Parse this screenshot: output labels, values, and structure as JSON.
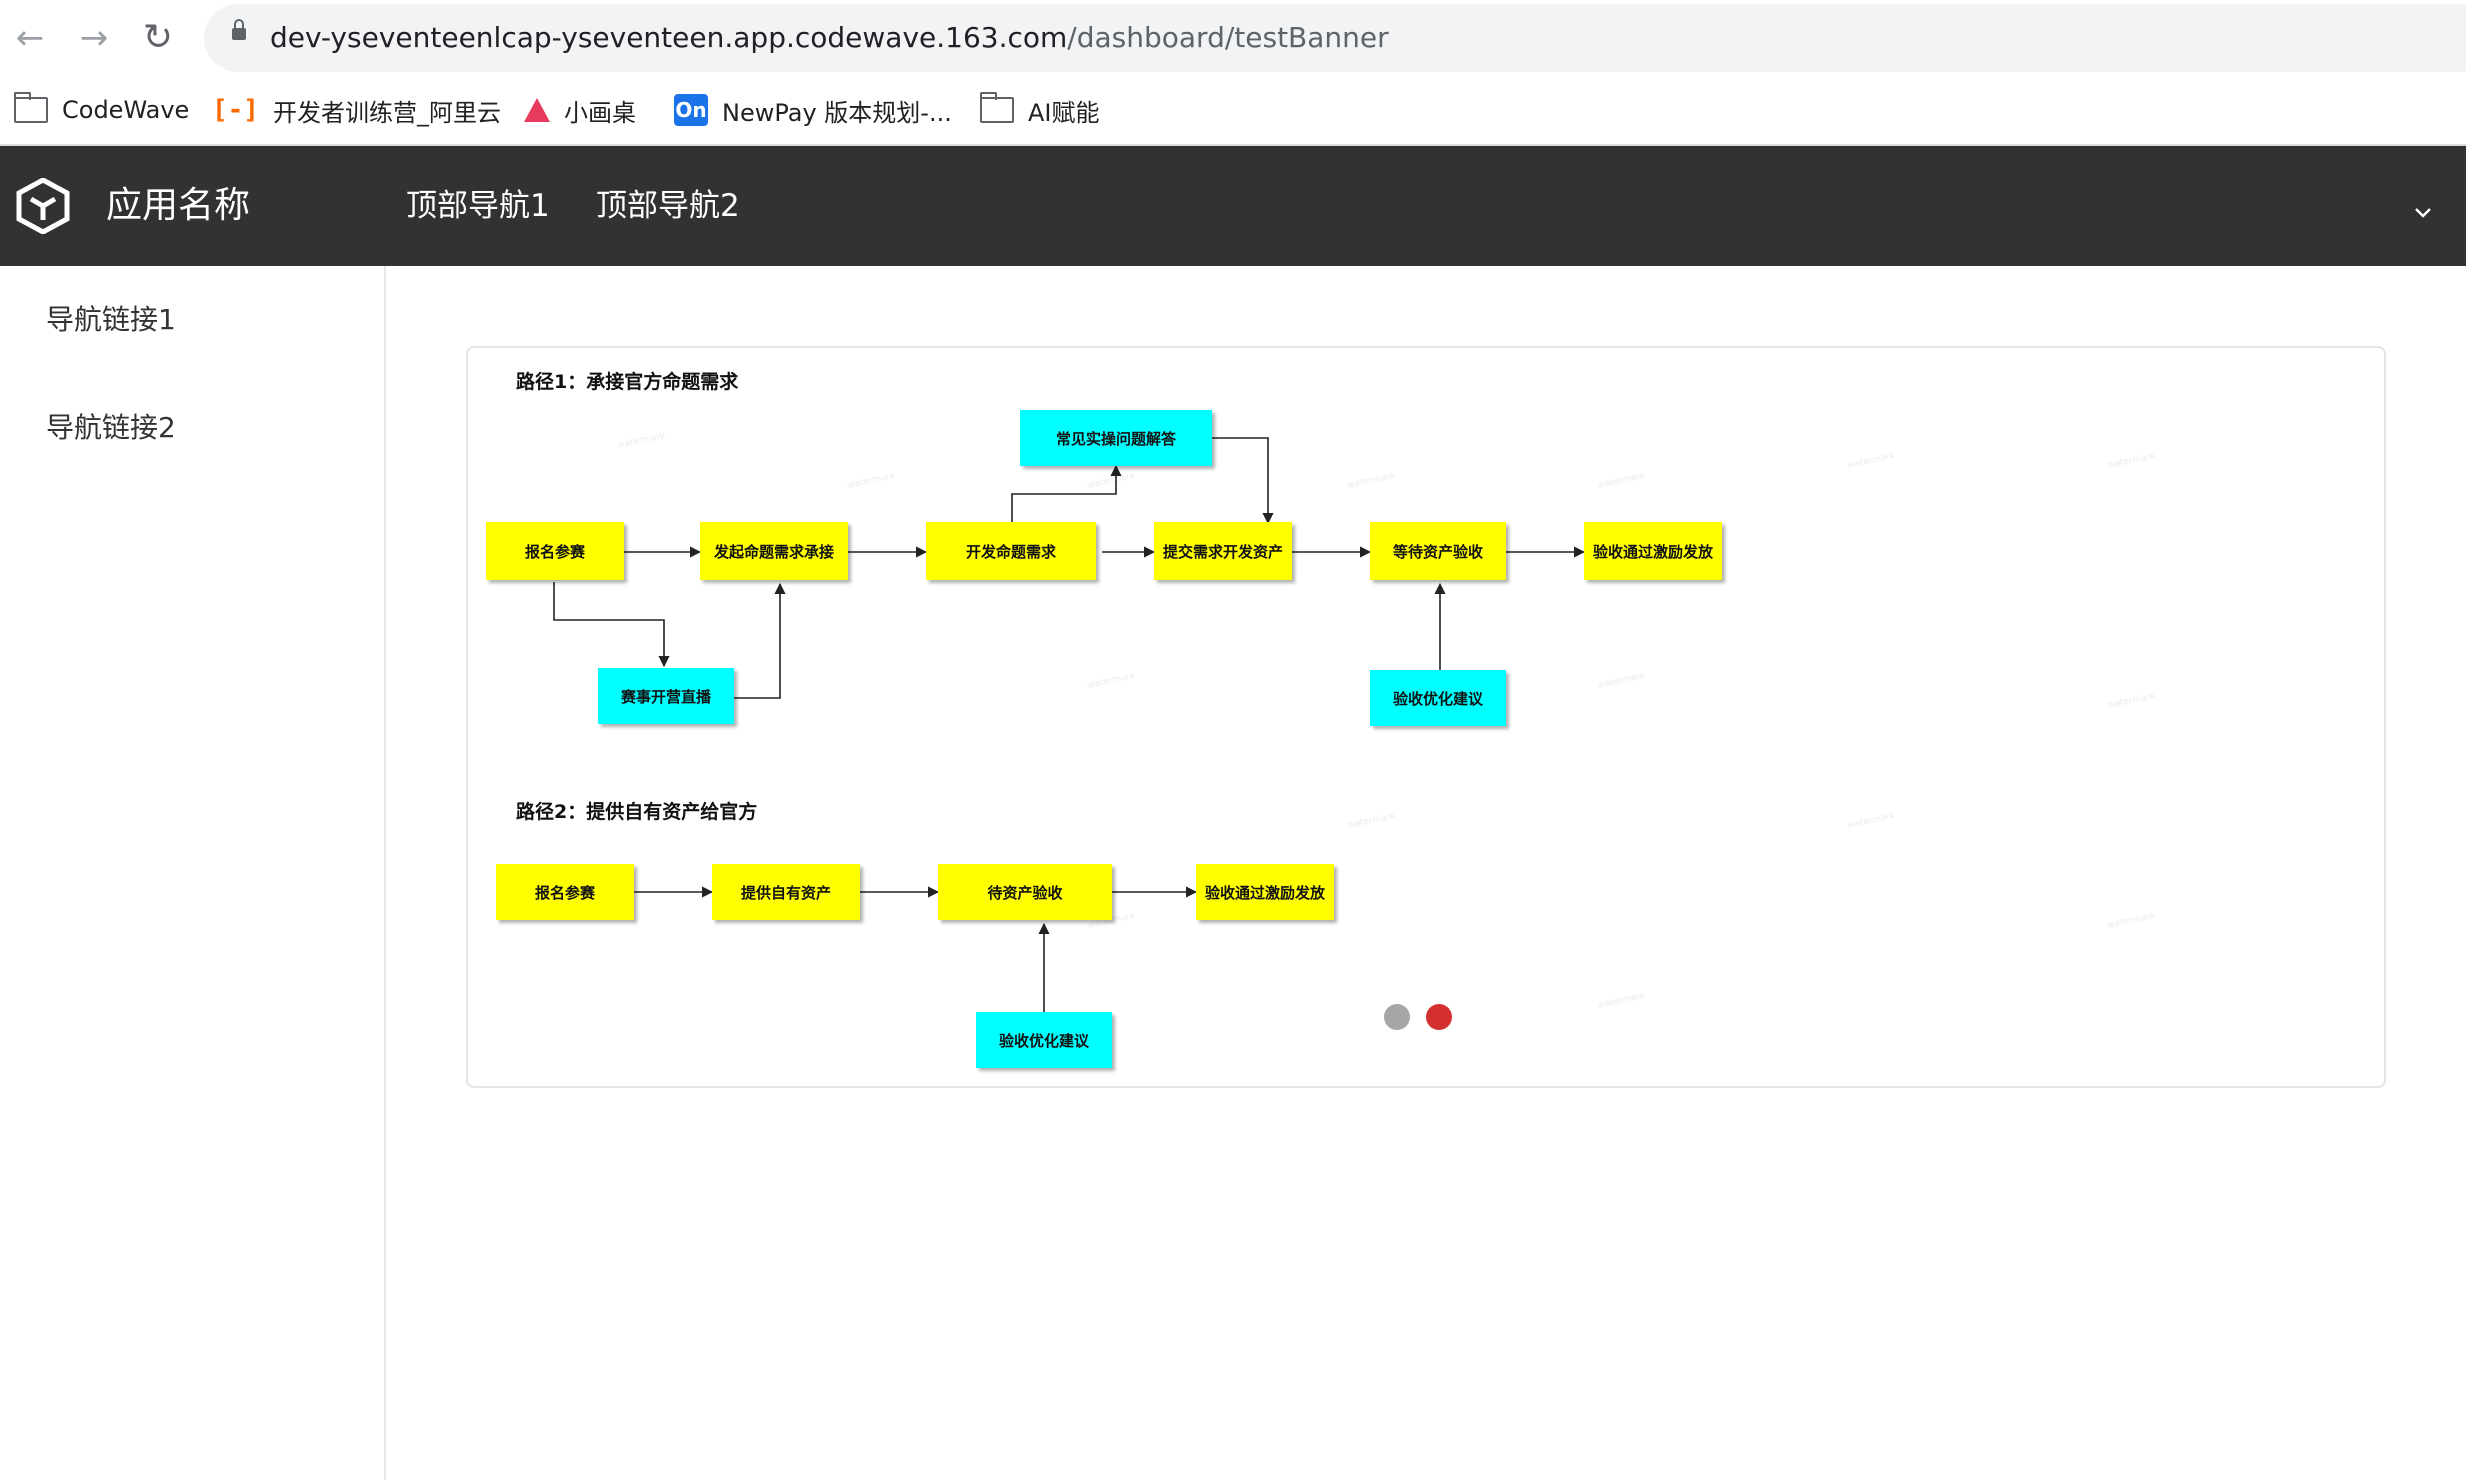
{
  "browser": {
    "url_host": "dev-yseventeenlcap-yseventeen.app.codewave.163.com",
    "url_path": "/dashboard/testBanner",
    "back_icon": "back-arrow-icon",
    "forward_icon": "forward-arrow-icon",
    "reload_icon": "reload-icon",
    "bookmarks": [
      {
        "label": "CodeWave",
        "icon": "folder-icon"
      },
      {
        "label": "开发者训练营_阿里云",
        "icon": "aliyun-icon",
        "glyph": "[-]"
      },
      {
        "label": "小画桌",
        "icon": "xiaohuazhuo-icon"
      },
      {
        "label": "NewPay 版本规划-...",
        "icon": "onenote-icon",
        "glyph": "On"
      },
      {
        "label": "AI赋能",
        "icon": "folder-icon"
      }
    ]
  },
  "header": {
    "app_name": "应用名称",
    "nav": [
      "顶部导航1",
      "顶部导航2"
    ],
    "background": "#323232"
  },
  "sidebar": {
    "links": [
      "导航链接1",
      "导航链接2"
    ]
  },
  "banner": {
    "path1": {
      "title": "路径1：承接官方命题需求",
      "nodes": {
        "signup": "报名参赛",
        "initiate": "发起命题需求承接",
        "develop": "开发命题需求",
        "submit": "提交需求开发资产",
        "await": "等待资产验收",
        "reward": "验收通过激励发放",
        "faq": "常见实操问题解答",
        "live": "赛事开营直播",
        "optimize": "验收优化建议"
      }
    },
    "path2": {
      "title": "路径2：提供自有资产给官方",
      "nodes": {
        "signup": "报名参赛",
        "provide": "提供自有资产",
        "pending": "待资产验收",
        "reward": "验收通过激励发放",
        "optimize": "验收优化建议"
      }
    },
    "colors": {
      "yellow": "#ffff00",
      "cyan": "#00ffff"
    },
    "carousel": {
      "total_slides": 2,
      "active_slide": 2,
      "dot_inactive": "#a6a6a6",
      "dot_active": "#d32f2f"
    }
  }
}
